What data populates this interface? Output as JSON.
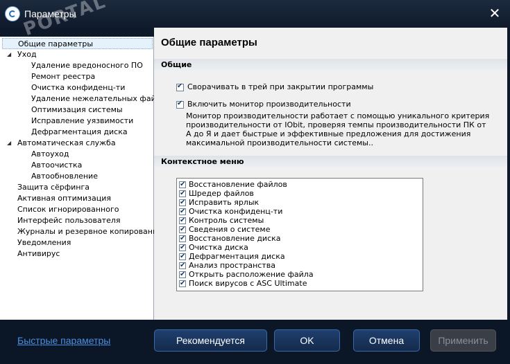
{
  "window": {
    "title": "Параметры",
    "watermark": "PORTAL",
    "close_glyph": "✕"
  },
  "sidebar": {
    "items": [
      {
        "label": "Общие параметры",
        "level": 0,
        "selected": true
      },
      {
        "label": "Уход",
        "level": 0,
        "expanded": true
      },
      {
        "label": "Удаление вредоносного ПО",
        "level": 1
      },
      {
        "label": "Ремонт реестра",
        "level": 1
      },
      {
        "label": "Очистка конфиденц-ти",
        "level": 1
      },
      {
        "label": "Удаление нежелательных файлов",
        "level": 1
      },
      {
        "label": "Оптимизация системы",
        "level": 1
      },
      {
        "label": "Исправление уязвимости",
        "level": 1
      },
      {
        "label": "Дефрагментация диска",
        "level": 1
      },
      {
        "label": "Автоматическая служба",
        "level": 0,
        "expanded": true
      },
      {
        "label": "Автоуход",
        "level": 1
      },
      {
        "label": "Автоочистка",
        "level": 1
      },
      {
        "label": "Автообновление",
        "level": 1
      },
      {
        "label": "Защита сёрфинга",
        "level": 0
      },
      {
        "label": "Активная оптимизация",
        "level": 0
      },
      {
        "label": "Список игнорированного",
        "level": 0
      },
      {
        "label": "Интерфейс пользователя",
        "level": 0
      },
      {
        "label": "Журналы и резервное копирование",
        "level": 0
      },
      {
        "label": "Уведомления",
        "level": 0
      },
      {
        "label": "Антивирус",
        "level": 0
      }
    ]
  },
  "main": {
    "title": "Общие параметры",
    "general_section": "Общие",
    "minimize_to_tray": {
      "label": "Сворачивать в трей при закрытии программы",
      "checked": true
    },
    "perf_monitor": {
      "label": "Включить монитор производительности",
      "checked": true
    },
    "perf_description": "Монитор производительности работает с помощью уникального критерия производительности от IObit, проверяя темпы производительности ПК от А до Я и дает быстрые и эффективные предложения для достижения максимальной производительности системы..",
    "context_section": "Контекстное меню",
    "context_items": [
      {
        "label": "Восстановление файлов",
        "checked": true
      },
      {
        "label": "Шредер файлов",
        "checked": true
      },
      {
        "label": "Исправить ярлык",
        "checked": true
      },
      {
        "label": "Очистка конфиденц-ти",
        "checked": true
      },
      {
        "label": "Контроль системы",
        "checked": true
      },
      {
        "label": "Сведения о системе",
        "checked": true
      },
      {
        "label": "Восстановление диска",
        "checked": true
      },
      {
        "label": "Очистка диска",
        "checked": true
      },
      {
        "label": "Дефрагментация диска",
        "checked": true
      },
      {
        "label": "Анализ пространства",
        "checked": true
      },
      {
        "label": "Открыть расположение файла",
        "checked": true
      },
      {
        "label": "Поиск вирусов с ASC Ultimate",
        "checked": true
      }
    ]
  },
  "footer": {
    "quick_settings": "Быстрые параметры",
    "recommended": "Рекомендуется",
    "ok": "OK",
    "cancel": "Отмена",
    "apply": "Применить"
  }
}
